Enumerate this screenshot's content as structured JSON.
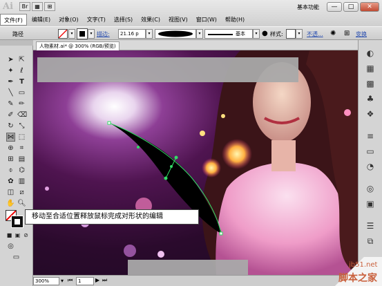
{
  "app": {
    "logo": "Ai",
    "workspace": "基本功能"
  },
  "menu": [
    "文件(F)",
    "编辑(E)",
    "对象(O)",
    "文字(T)",
    "选择(S)",
    "效果(C)",
    "视图(V)",
    "窗口(W)",
    "帮助(H)"
  ],
  "window_buttons": {
    "minimize": "—",
    "restore": "□",
    "close": "✕"
  },
  "control_bar": {
    "selection_label": "路径",
    "stroke_label": "描边:",
    "stroke_value": "21.16 p",
    "profile_label": "基本",
    "style_label": "样式:",
    "opacity_label": "不透...",
    "transform_label": "变换"
  },
  "document": {
    "tab": "人物素材.ai* @ 300% (RGB/预览)"
  },
  "status": {
    "zoom": "300%",
    "page": "1"
  },
  "callout": "移动至合适位置释放鼠标完成对形状的编辑",
  "watermark": {
    "site": "jb51.net",
    "name": "脚本之家"
  },
  "colors": {
    "canvas_dark": "#2a0a2c",
    "path_green": "#33dd66",
    "ui_gray": "#d4d4d4"
  }
}
